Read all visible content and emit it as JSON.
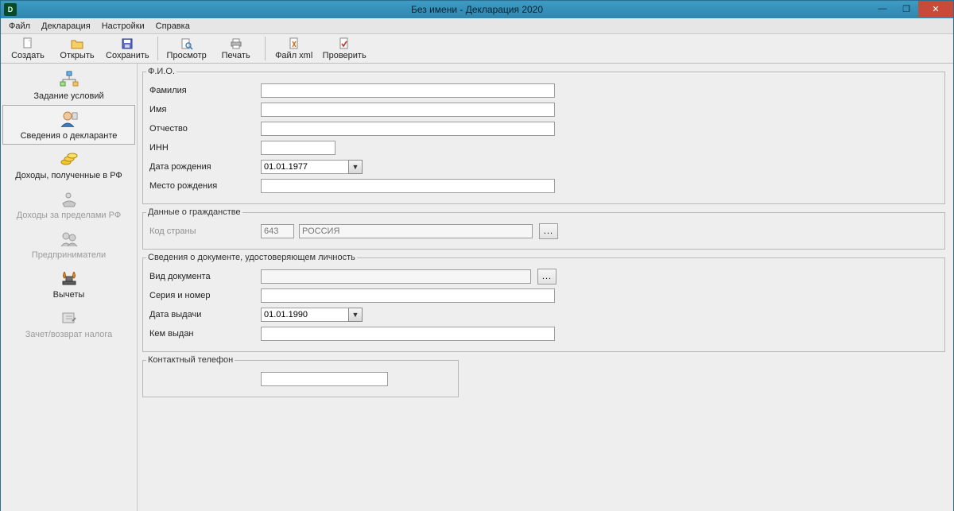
{
  "window": {
    "title": "Без имени - Декларация 2020"
  },
  "menu": {
    "file": "Файл",
    "declaration": "Декларация",
    "settings": "Настройки",
    "help": "Справка"
  },
  "toolbar": {
    "create": "Создать",
    "open": "Открыть",
    "save": "Сохранить",
    "preview": "Просмотр",
    "print": "Печать",
    "filexml": "Файл xml",
    "check": "Проверить"
  },
  "sidebar": {
    "conditions": "Задание условий",
    "declarant": "Сведения о декларанте",
    "income_rf": "Доходы, полученные в РФ",
    "income_abroad": "Доходы за пределами РФ",
    "entrepreneurs": "Предприниматели",
    "deductions": "Вычеты",
    "offset_refund": "Зачет/возврат налога"
  },
  "form": {
    "fio_group": "Ф.И.О.",
    "surname": "Фамилия",
    "name": "Имя",
    "patronymic": "Отчество",
    "inn": "ИНН",
    "birth_date_label": "Дата рождения",
    "birth_date_value": "01.01.1977",
    "birth_place": "Место рождения",
    "citizenship_group": "Данные о гражданстве",
    "country_code_label": "Код страны",
    "country_code_value": "643",
    "country_name_value": "РОССИЯ",
    "identity_group": "Сведения о документе, удостоверяющем личность",
    "doc_type": "Вид документа",
    "series_number": "Серия и номер",
    "issue_date_label": "Дата выдачи",
    "issue_date_value": "01.01.1990",
    "issued_by": "Кем выдан",
    "contact_group": "Контактный телефон",
    "ellipsis": "..."
  }
}
